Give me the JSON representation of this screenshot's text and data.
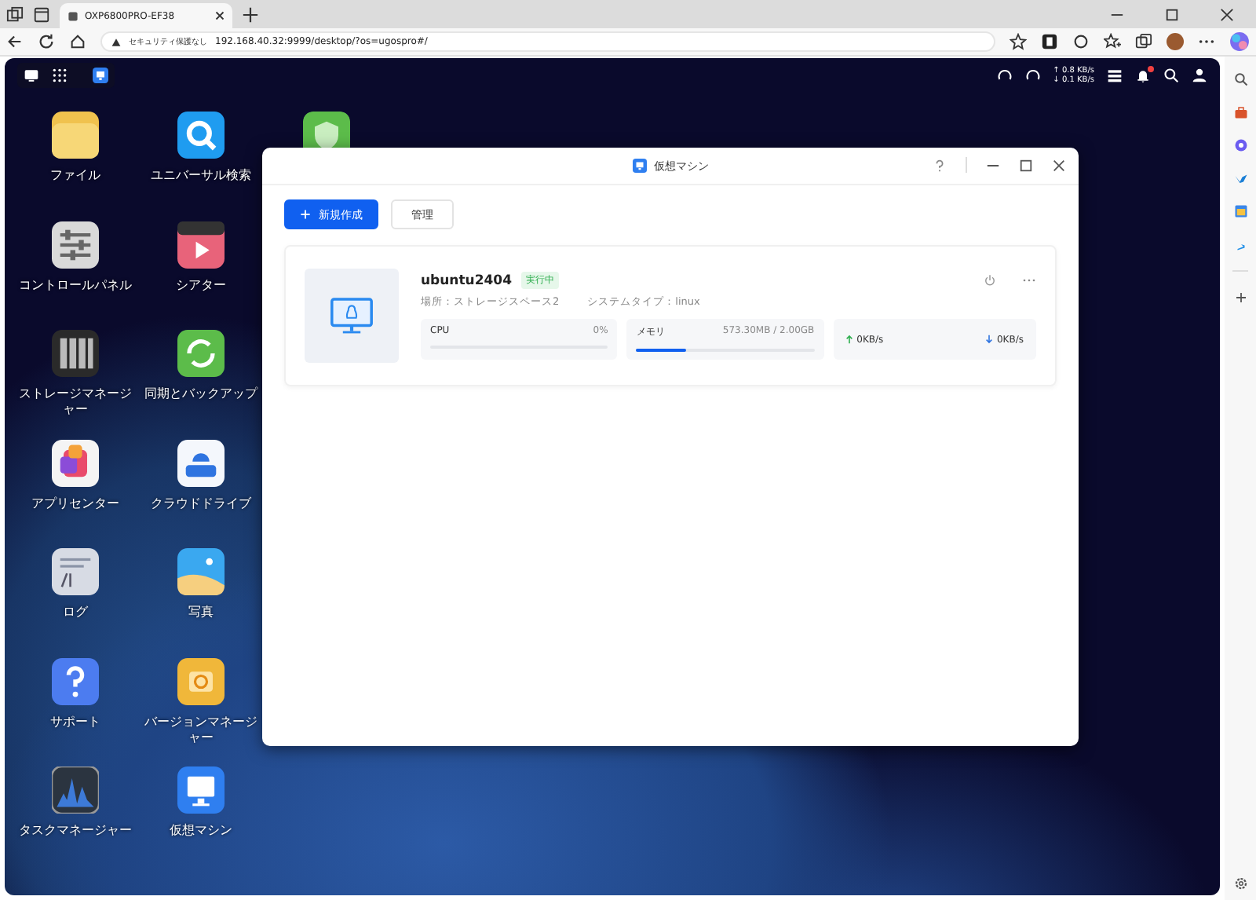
{
  "browser": {
    "tab_title": "OXP6800PRO-EF38",
    "security_label": "セキュリティ保護なし",
    "url": "192.168.40.32:9999/desktop/?os=ugospro#/"
  },
  "topbar": {
    "upload": "↑ 0.8 KB/s",
    "download": "↓ 0.1 KB/s",
    "has_notification": true
  },
  "desktop_icons": [
    {
      "label": "ファイル",
      "kind": "folder"
    },
    {
      "label": "コントロールパネル",
      "kind": "control"
    },
    {
      "label": "ストレージマネージャー",
      "kind": "storage"
    },
    {
      "label": "アプリセンター",
      "kind": "apps"
    },
    {
      "label": "ログ",
      "kind": "logs"
    },
    {
      "label": "サポート",
      "kind": "help"
    },
    {
      "label": "タスクマネージャー",
      "kind": "task"
    },
    {
      "label": "ユニバーサル検索",
      "kind": "search"
    },
    {
      "label": "シアター",
      "kind": "theater"
    },
    {
      "label": "同期とバックアップ",
      "kind": "sync"
    },
    {
      "label": "クラウドドライブ",
      "kind": "cloud"
    },
    {
      "label": "写真",
      "kind": "photos"
    },
    {
      "label": "バージョンマネージャー",
      "kind": "version"
    },
    {
      "label": "仮想マシン",
      "kind": "vm"
    },
    {
      "kind": "shield"
    }
  ],
  "window": {
    "title": "仮想マシン",
    "buttons": [
      {
        "label": "新規作成",
        "primary": true
      },
      {
        "label": "管理",
        "primary": false
      }
    ],
    "vms": [
      {
        "name": "ubuntu2404",
        "status": "実行中",
        "location": "場所：ストレージスペース2",
        "system_type": "システムタイプ：linux",
        "cpu": {
          "label": "CPU",
          "reading": "0%",
          "level": 0
        },
        "memory": {
          "label": "メモリ",
          "reading": "573.30MB / 2.00GB",
          "level": 0.28
        },
        "upload": "0KB/s",
        "download": "0KB/s"
      }
    ]
  }
}
